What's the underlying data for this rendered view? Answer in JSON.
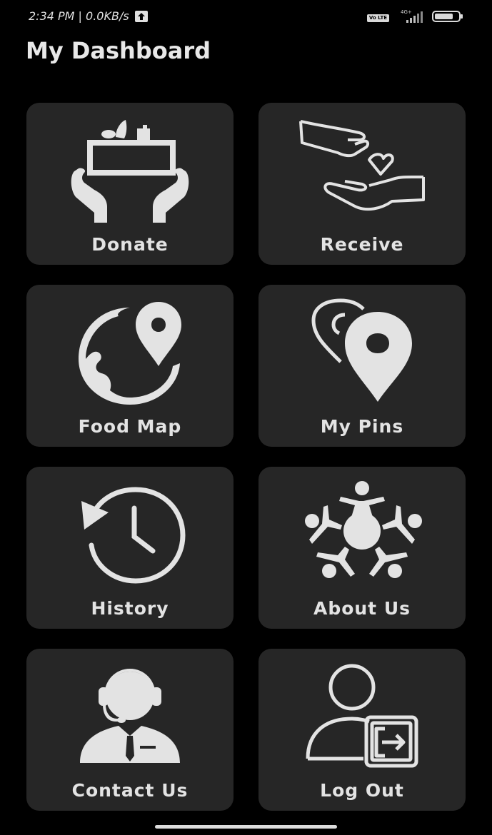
{
  "status_bar": {
    "time_speed": "2:34 PM | 0.0KB/s",
    "volte": "Vo LTE",
    "network": "4G+"
  },
  "page_title": "My Dashboard",
  "tiles": [
    {
      "label": "Donate",
      "icon": "donate-hands-box-icon"
    },
    {
      "label": "Receive",
      "icon": "receive-hands-heart-icon"
    },
    {
      "label": "Food Map",
      "icon": "globe-pin-icon"
    },
    {
      "label": "My Pins",
      "icon": "location-pin-icon"
    },
    {
      "label": "History",
      "icon": "history-clock-icon"
    },
    {
      "label": "About Us",
      "icon": "community-people-icon"
    },
    {
      "label": "Contact Us",
      "icon": "headset-agent-icon"
    },
    {
      "label": "Log Out",
      "icon": "user-logout-icon"
    }
  ],
  "colors": {
    "background": "#000000",
    "tile": "#262626",
    "foreground": "#e3e3e3"
  }
}
